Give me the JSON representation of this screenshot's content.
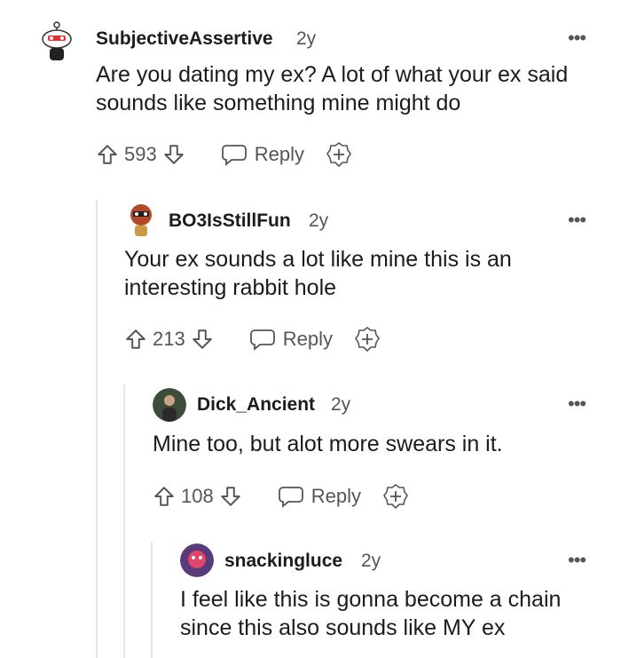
{
  "comments": [
    {
      "username": "SubjectiveAssertive",
      "age": "2y",
      "text": "Are you dating my ex? A lot of what your ex said sounds like something mine might do",
      "votes": "593",
      "reply_label": "Reply"
    },
    {
      "username": "BO3IsStillFun",
      "age": "2y",
      "text": "Your ex sounds a lot like mine this is an interesting rabbit hole",
      "votes": "213",
      "reply_label": "Reply"
    },
    {
      "username": "Dick_Ancient",
      "age": "2y",
      "text": "Mine too, but alot more swears in it.",
      "votes": "108",
      "reply_label": "Reply"
    },
    {
      "username": "snackingluce",
      "age": "2y",
      "text": "I feel like this is gonna become a chain since this also sounds like MY ex"
    }
  ],
  "icons": {
    "upvote": "upvote-icon",
    "downvote": "downvote-icon",
    "reply": "reply-icon",
    "award": "award-icon",
    "more": "more-options-icon"
  },
  "colors": {
    "text": "#1c1c1c",
    "meta": "#555555",
    "thread_line": "#e5e5e5"
  }
}
